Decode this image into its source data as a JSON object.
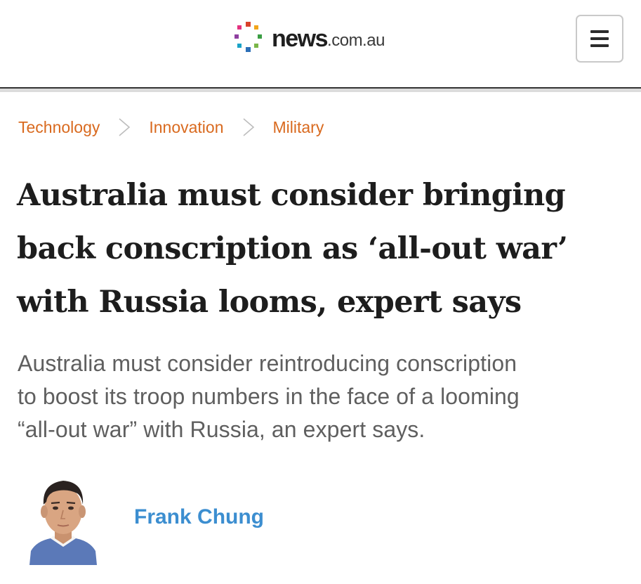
{
  "header": {
    "logo_word": "news",
    "logo_domain": ".com.au",
    "logo_icon": "news-dots-logo",
    "menu_icon": "hamburger-icon",
    "logo_colors": [
      "#d9412b",
      "#f2a51a",
      "#3b9e43",
      "#2c6fb7",
      "#8e3fa0",
      "#e4317f",
      "#1aa3c7",
      "#7ab648"
    ]
  },
  "breadcrumb": {
    "items": [
      "Technology",
      "Innovation",
      "Military"
    ],
    "separator_icon": "chevron-right-icon",
    "color": "#d96a1f"
  },
  "article": {
    "headline_lines": [
      "Australia must consider bringing",
      "back conscription as ‘all-out war’",
      "with Russia looms, expert says"
    ],
    "standfirst_lines": [
      "Australia must consider reintroducing conscription",
      "to boost its troop numbers in the face of a looming",
      "“all-out war” with Russia, an expert says."
    ]
  },
  "author": {
    "name": "Frank Chung",
    "avatar_icon": "author-avatar",
    "name_color": "#3c8ed0"
  }
}
